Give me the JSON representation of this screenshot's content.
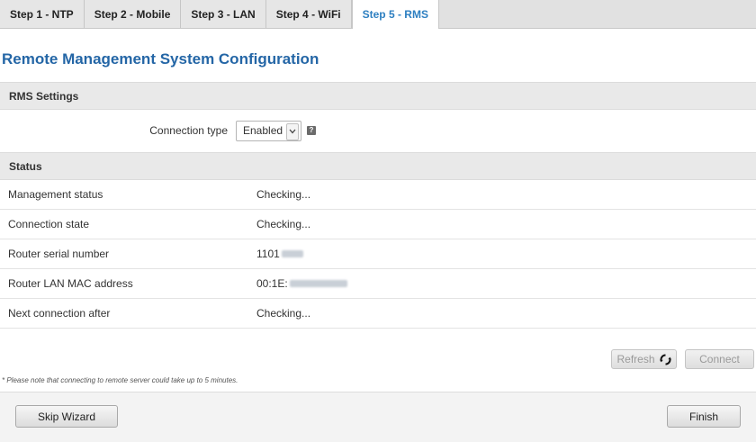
{
  "tabs": [
    {
      "label": "Step 1 - NTP",
      "active": false
    },
    {
      "label": "Step 2 - Mobile",
      "active": false
    },
    {
      "label": "Step 3 - LAN",
      "active": false
    },
    {
      "label": "Step 4 - WiFi",
      "active": false
    },
    {
      "label": "Step 5 - RMS",
      "active": true
    }
  ],
  "page_title": "Remote Management System Configuration",
  "rms_settings": {
    "header": "RMS Settings",
    "connection_type_label": "Connection type",
    "connection_type_value": "Enabled",
    "help_icon": "question-icon"
  },
  "status": {
    "header": "Status",
    "rows": [
      {
        "label": "Management status",
        "value": "Checking..."
      },
      {
        "label": "Connection state",
        "value": "Checking..."
      },
      {
        "label": "Router serial number",
        "value": "1101"
      },
      {
        "label": "Router LAN MAC address",
        "value": "00:1E:"
      },
      {
        "label": "Next connection after",
        "value": "Checking..."
      }
    ]
  },
  "buttons": {
    "refresh": "Refresh",
    "refresh_icon": "refresh-icon",
    "connect": "Connect",
    "skip": "Skip Wizard",
    "finish": "Finish"
  },
  "note": "* Please note that connecting to remote server could take up to 5 minutes.",
  "colors": {
    "title": "#2466a6",
    "active_tab": "#2d7fc1",
    "header_bg": "#e9e9e9"
  }
}
